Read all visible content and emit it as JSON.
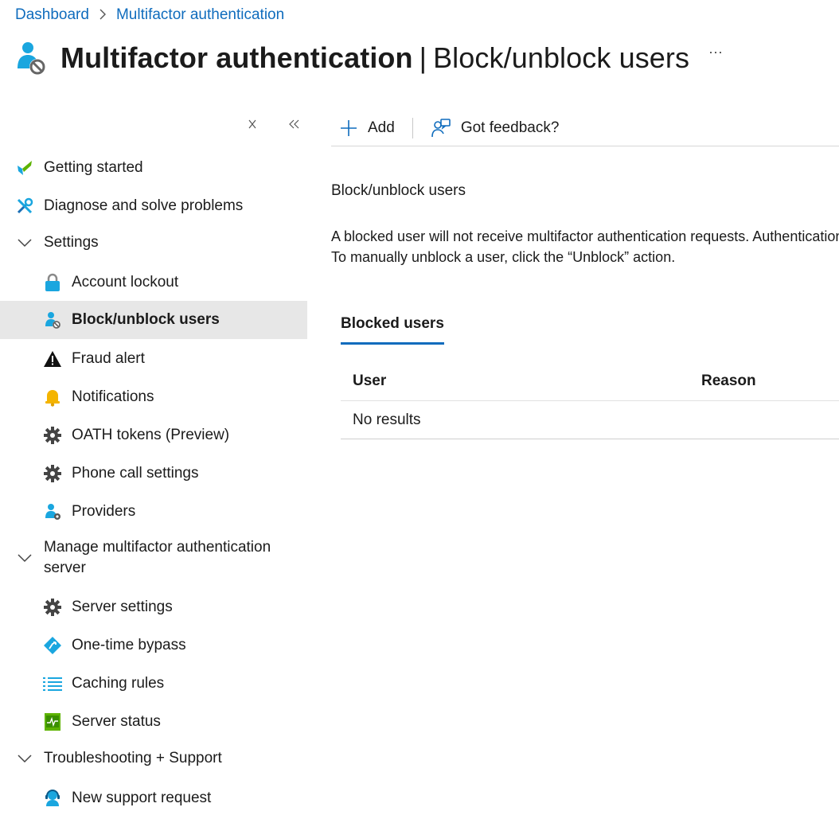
{
  "breadcrumb": {
    "items": [
      "Dashboard",
      "Multifactor authentication"
    ],
    "separator": ">"
  },
  "header": {
    "title_strong": "Multifactor authentication",
    "divider": "|",
    "title_sub": "Block/unblock users",
    "more_label": "···",
    "icon": "user-block-icon"
  },
  "sidebar": {
    "close_icon": "close-icon",
    "collapse_icon": "double-chevron-left-icon",
    "items": [
      {
        "label": "Getting started",
        "icon": "quickstart-icon"
      },
      {
        "label": "Diagnose and solve problems",
        "icon": "wrench-icon"
      },
      {
        "label": "Settings",
        "icon": "chevron-down-icon"
      },
      {
        "label": "Account lockout",
        "icon": "lock-icon"
      },
      {
        "label": "Block/unblock users",
        "icon": "user-block-icon",
        "selected": true
      },
      {
        "label": "Fraud alert",
        "icon": "warning-icon"
      },
      {
        "label": "Notifications",
        "icon": "bell-icon"
      },
      {
        "label": "OATH tokens (Preview)",
        "icon": "gear-icon"
      },
      {
        "label": "Phone call settings",
        "icon": "gear-icon"
      },
      {
        "label": "Providers",
        "icon": "user-gear-icon"
      },
      {
        "label": "Manage multifactor authentication server",
        "icon": "chevron-down-icon"
      },
      {
        "label": "Server settings",
        "icon": "gear-icon"
      },
      {
        "label": "One-time bypass",
        "icon": "bypass-icon"
      },
      {
        "label": "Caching rules",
        "icon": "list-icon"
      },
      {
        "label": "Server status",
        "icon": "server-status-icon"
      },
      {
        "label": "Troubleshooting + Support",
        "icon": "chevron-down-icon"
      },
      {
        "label": "New support request",
        "icon": "support-icon"
      }
    ]
  },
  "toolbar": {
    "add_label": "Add",
    "feedback_label": "Got feedback?"
  },
  "main": {
    "section_title": "Block/unblock users",
    "description_line1": "A blocked user will not receive multifactor authentication requests. Authentication attempts for that user will be automatically denied.",
    "description_line2": "To manually unblock a user, click the “Unblock” action.",
    "tab_label": "Blocked users",
    "table": {
      "columns": [
        "User",
        "Reason"
      ],
      "empty_text": "No results"
    }
  },
  "colors": {
    "accent": "#0f6cbd",
    "selected_bg": "#e7e7e7",
    "icon_blue": "#0078d4",
    "bell_yellow": "#f4b400",
    "status_green": "#5db300"
  }
}
